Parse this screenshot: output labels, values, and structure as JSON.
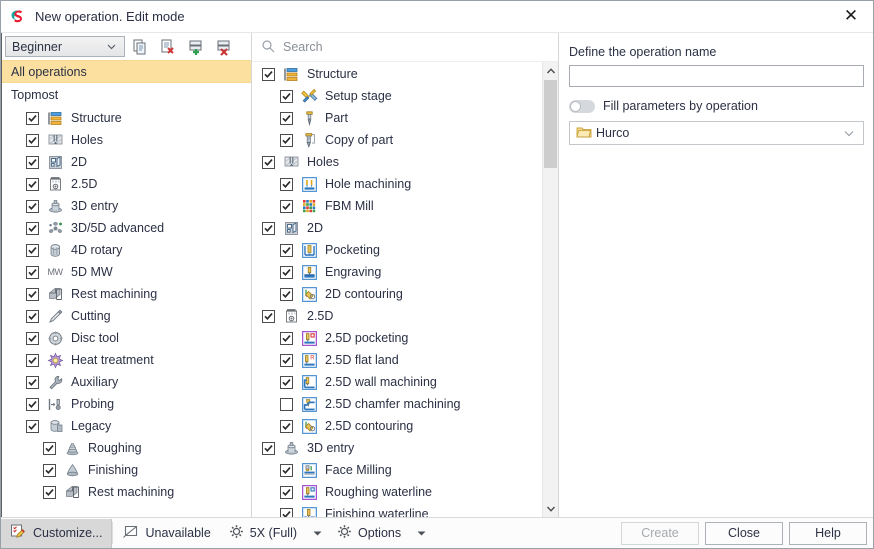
{
  "window": {
    "title": "New operation. Edit mode",
    "logo_icon": "sprutcam-logo-icon",
    "close_icon": "close-icon"
  },
  "left_panel": {
    "mode_combo": {
      "value": "Beginner",
      "caret_icon": "chevron-down-icon"
    },
    "toolbar_buttons": [
      {
        "name": "copy-operation-button",
        "icon": "copy-icon"
      },
      {
        "name": "delete-copy-button",
        "icon": "copy-delete-icon"
      },
      {
        "name": "add-group-button",
        "icon": "group-add-icon"
      },
      {
        "name": "delete-group-button",
        "icon": "group-delete-icon"
      }
    ],
    "all_operations_label": "All operations",
    "topmost_label": "Topmost",
    "items": [
      {
        "label": "Structure",
        "checked": true,
        "level": 1,
        "icon": "structure-icon"
      },
      {
        "label": "Holes",
        "checked": true,
        "level": 1,
        "icon": "holes-icon"
      },
      {
        "label": "2D",
        "checked": true,
        "level": 1,
        "icon": "twod-icon"
      },
      {
        "label": "2.5D",
        "checked": true,
        "level": 1,
        "icon": "twofived-icon"
      },
      {
        "label": "3D entry",
        "checked": true,
        "level": 1,
        "icon": "threed-entry-icon"
      },
      {
        "label": "3D/5D advanced",
        "checked": true,
        "level": 1,
        "icon": "threed-fived-advanced-icon"
      },
      {
        "label": "4D rotary",
        "checked": true,
        "level": 1,
        "icon": "fourd-rotary-icon"
      },
      {
        "label": "5D MW",
        "checked": true,
        "level": 1,
        "icon": "fived-mw-icon"
      },
      {
        "label": "Rest machining",
        "checked": true,
        "level": 1,
        "icon": "rest-machining-icon"
      },
      {
        "label": "Cutting",
        "checked": true,
        "level": 1,
        "icon": "cutting-icon"
      },
      {
        "label": "Disc tool",
        "checked": true,
        "level": 1,
        "icon": "disc-tool-icon"
      },
      {
        "label": "Heat treatment",
        "checked": true,
        "level": 1,
        "icon": "heat-treatment-icon"
      },
      {
        "label": "Auxiliary",
        "checked": true,
        "level": 1,
        "icon": "auxiliary-icon"
      },
      {
        "label": "Probing",
        "checked": true,
        "level": 1,
        "icon": "probing-icon"
      },
      {
        "label": "Legacy",
        "checked": true,
        "level": 1,
        "icon": "legacy-icon"
      },
      {
        "label": "Roughing",
        "checked": true,
        "level": 2,
        "icon": "roughing-icon"
      },
      {
        "label": "Finishing",
        "checked": true,
        "level": 2,
        "icon": "finishing-icon"
      },
      {
        "label": "Rest machining",
        "checked": true,
        "level": 2,
        "icon": "rest-machining-icon"
      }
    ]
  },
  "mid_panel": {
    "search": {
      "placeholder": "Search",
      "value": "",
      "icon": "search-icon"
    },
    "scrollbar": {
      "up_icon": "chevron-up-icon",
      "down_icon": "chevron-down-icon"
    },
    "items": [
      {
        "label": "Structure",
        "checked": true,
        "level": 0,
        "icon": "structure-icon"
      },
      {
        "label": "Setup stage",
        "checked": true,
        "level": 1,
        "icon": "setup-stage-icon"
      },
      {
        "label": "Part",
        "checked": true,
        "level": 1,
        "icon": "part-icon"
      },
      {
        "label": "Copy of part",
        "checked": true,
        "level": 1,
        "icon": "copy-of-part-icon"
      },
      {
        "label": "Holes",
        "checked": true,
        "level": 0,
        "icon": "holes-icon"
      },
      {
        "label": "Hole machining",
        "checked": true,
        "level": 1,
        "icon": "hole-machining-icon"
      },
      {
        "label": "FBM Mill",
        "checked": true,
        "level": 1,
        "icon": "fbm-mill-icon"
      },
      {
        "label": "2D",
        "checked": true,
        "level": 0,
        "icon": "twod-icon"
      },
      {
        "label": "Pocketing",
        "checked": true,
        "level": 1,
        "icon": "pocketing-icon"
      },
      {
        "label": "Engraving",
        "checked": true,
        "level": 1,
        "icon": "engraving-icon"
      },
      {
        "label": "2D contouring",
        "checked": true,
        "level": 1,
        "icon": "twod-contouring-icon"
      },
      {
        "label": "2.5D",
        "checked": true,
        "level": 0,
        "icon": "twofived-icon"
      },
      {
        "label": "2.5D pocketing",
        "checked": true,
        "level": 1,
        "icon": "twofived-pocketing-icon"
      },
      {
        "label": "2.5D flat land",
        "checked": true,
        "level": 1,
        "icon": "twofived-flat-land-icon"
      },
      {
        "label": "2.5D wall machining",
        "checked": true,
        "level": 1,
        "icon": "twofived-wall-machining-icon"
      },
      {
        "label": "2.5D chamfer machining",
        "checked": false,
        "level": 1,
        "icon": "twofived-chamfer-machining-icon"
      },
      {
        "label": "2.5D contouring",
        "checked": true,
        "level": 1,
        "icon": "twofived-contouring-icon"
      },
      {
        "label": "3D entry",
        "checked": true,
        "level": 0,
        "icon": "threed-entry-icon"
      },
      {
        "label": "Face Milling",
        "checked": true,
        "level": 1,
        "icon": "face-milling-icon"
      },
      {
        "label": "Roughing waterline",
        "checked": true,
        "level": 1,
        "icon": "roughing-waterline-icon"
      },
      {
        "label": "Finishing waterline",
        "checked": true,
        "level": 1,
        "icon": "finishing-waterline-icon"
      }
    ]
  },
  "right_panel": {
    "name_label": "Define the operation name",
    "name_value": "",
    "fill_params_label": "Fill parameters by operation",
    "fill_params_on": false,
    "machine_select": {
      "value": "Hurco",
      "icon": "folder-icon",
      "caret_icon": "chevron-down-icon"
    }
  },
  "footer": {
    "customize": {
      "label": "Customize...",
      "icon": "customize-icon"
    },
    "unavailable": {
      "label": "Unavailable",
      "icon": "unavailable-icon"
    },
    "axis_mode": {
      "label": "5X (Full)",
      "icon": "gear-icon",
      "caret_icon": "chevron-down-icon"
    },
    "options": {
      "label": "Options",
      "icon": "gear-icon",
      "caret_icon": "chevron-down-icon"
    },
    "create_button": {
      "label": "Create",
      "disabled": true
    },
    "close_button": {
      "label": "Close",
      "disabled": false
    },
    "help_button": {
      "label": "Help",
      "disabled": false
    }
  }
}
